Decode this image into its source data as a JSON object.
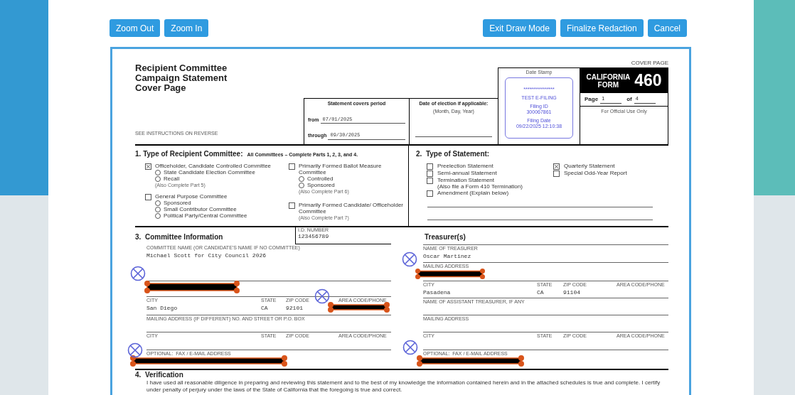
{
  "toolbar": {
    "left_buttons": [
      "Zoom Out",
      "Zoom In"
    ],
    "right_buttons": [
      "Exit Draw Mode",
      "Finalize Redaction",
      "Cancel"
    ]
  },
  "header": {
    "title_lines": [
      "Recipient Committee",
      "Campaign Statement",
      "Cover Page"
    ],
    "instructions": "SEE INSTRUCTIONS ON REVERSE",
    "cover_page": "COVER PAGE",
    "period": {
      "heading": "Statement covers period",
      "from_label": "from",
      "from_value": "07/01/2025",
      "through_label": "through",
      "through_value": "09/30/2025"
    },
    "election": {
      "heading": "Date of election if applicable:",
      "subheading": "(Month, Day, Year)"
    },
    "date_stamp": {
      "label": "Date Stamp",
      "groups": [
        {
          "lines": [
            "****************"
          ]
        },
        {
          "lines": [
            "TEST E-FILING"
          ]
        },
        {
          "lines": [
            "Filing ID",
            "300067861"
          ]
        },
        {
          "lines": [
            "Filing Date",
            "09/22/2025 12:10:38"
          ]
        }
      ]
    },
    "form_badge": {
      "state": "CALIFORNIA",
      "word": "FORM",
      "number": "460"
    },
    "page": {
      "label": "Page",
      "value": "1",
      "of_label": "of",
      "total": "4"
    },
    "official_use": "For Official Use Only"
  },
  "section1": {
    "number": "1.",
    "title": "Type of Recipient Committee:",
    "note": "All Committees – Complete Parts 1, 2, 3, and 4.",
    "columns": [
      {
        "groups": [
          {
            "label": "Officeholder, Candidate Controlled Committee",
            "checked": true,
            "options": [
              {
                "label": "State Candidate Election Committee",
                "selected": false
              },
              {
                "label": "Recall",
                "selected": false
              }
            ],
            "note": "(Also Complete Part 5)"
          },
          {
            "label": "General Purpose Committee",
            "checked": false,
            "options": [
              {
                "label": "Sponsored",
                "selected": false
              },
              {
                "label": "Small Contributor Committee",
                "selected": false
              },
              {
                "label": "Political Party/Central Committee",
                "selected": false
              }
            ]
          }
        ]
      },
      {
        "groups": [
          {
            "label": "Primarily Formed Ballot Measure Committee",
            "checked": false,
            "options": [
              {
                "label": "Controlled",
                "selected": false
              },
              {
                "label": "Sponsored",
                "selected": false
              }
            ],
            "note": "(Also Complete Part 6)"
          },
          {
            "label": "Primarily Formed Candidate/ Officeholder Committee",
            "checked": false,
            "note": "(Also Complete Part 7)"
          }
        ]
      }
    ]
  },
  "section2": {
    "number": "2.",
    "title": "Type of Statement:",
    "columns": [
      {
        "items": [
          {
            "label": "Preelection Statement",
            "checked": false
          },
          {
            "label": "Semi-annual Statement",
            "checked": false
          },
          {
            "label": "Termination Statement",
            "checked": false,
            "note": "(Also file a Form 410 Termination)"
          },
          {
            "label": "Amendment (Explain below)",
            "checked": false
          }
        ]
      },
      {
        "items": [
          {
            "label": "Quarterly Statement",
            "checked": true
          },
          {
            "label": "Special Odd-Year Report",
            "checked": false
          }
        ]
      }
    ]
  },
  "section3": {
    "number": "3.",
    "title": "Committee Information",
    "id_label": "I.D. NUMBER",
    "id_value": "123456789",
    "fields": [
      {
        "kind": "single",
        "label": "COMMITTEE NAME (OR CANDIDATE'S NAME IF NO COMMITTEE)",
        "value": "Michael Scott for City Council 2026"
      },
      {
        "kind": "single"
      },
      {
        "kind": "row",
        "columns": [
          {
            "label": "CITY",
            "value": "San Diego"
          },
          {
            "label": "STATE",
            "value": "CA"
          },
          {
            "label": "ZIP CODE",
            "value": "92101"
          },
          {
            "label": "AREA CODE/PHONE"
          }
        ]
      },
      {
        "kind": "single",
        "label": "MAILING ADDRESS (IF DIFFERENT) NO. AND STREET OR P.O. BOX"
      },
      {
        "kind": "row",
        "columns": [
          {
            "label": "CITY"
          },
          {
            "label": "STATE"
          },
          {
            "label": "ZIP CODE"
          },
          {
            "label": "AREA CODE/PHONE"
          }
        ]
      },
      {
        "kind": "single",
        "label": "OPTIONAL:  FAX / E-MAIL ADDRESS"
      }
    ]
  },
  "treasurer": {
    "title": "Treasurer(s)",
    "fields": [
      {
        "kind": "single",
        "label": "NAME OF TREASURER",
        "value": "Oscar Martinez"
      },
      {
        "kind": "single",
        "label": "MAILING ADDRESS"
      },
      {
        "kind": "row",
        "columns": [
          {
            "label": "CITY",
            "value": "Pasadena"
          },
          {
            "label": "STATE",
            "value": "CA"
          },
          {
            "label": "ZIP CODE",
            "value": "91104"
          },
          {
            "label": "AREA CODE/PHONE"
          }
        ]
      },
      {
        "kind": "single",
        "label": "NAME OF ASSISTANT TREASURER, IF ANY"
      },
      {
        "kind": "single",
        "label": "MAILING ADDRESS"
      },
      {
        "kind": "row",
        "columns": [
          {
            "label": "CITY"
          },
          {
            "label": "STATE"
          },
          {
            "label": "ZIP CODE"
          },
          {
            "label": "AREA CODE/PHONE"
          }
        ]
      },
      {
        "kind": "single",
        "label": "OPTIONAL:  FAX / E-MAIL ADDRESS"
      }
    ]
  },
  "section4": {
    "number": "4.",
    "title": "Verification",
    "text": "I have used all reasonable diligence in preparing and reviewing this statement and to the best of my knowledge the information contained herein and in the attached schedules is true and complete.  I certify under penalty of perjury under the laws of the State of California that the foregoing is true and correct."
  }
}
